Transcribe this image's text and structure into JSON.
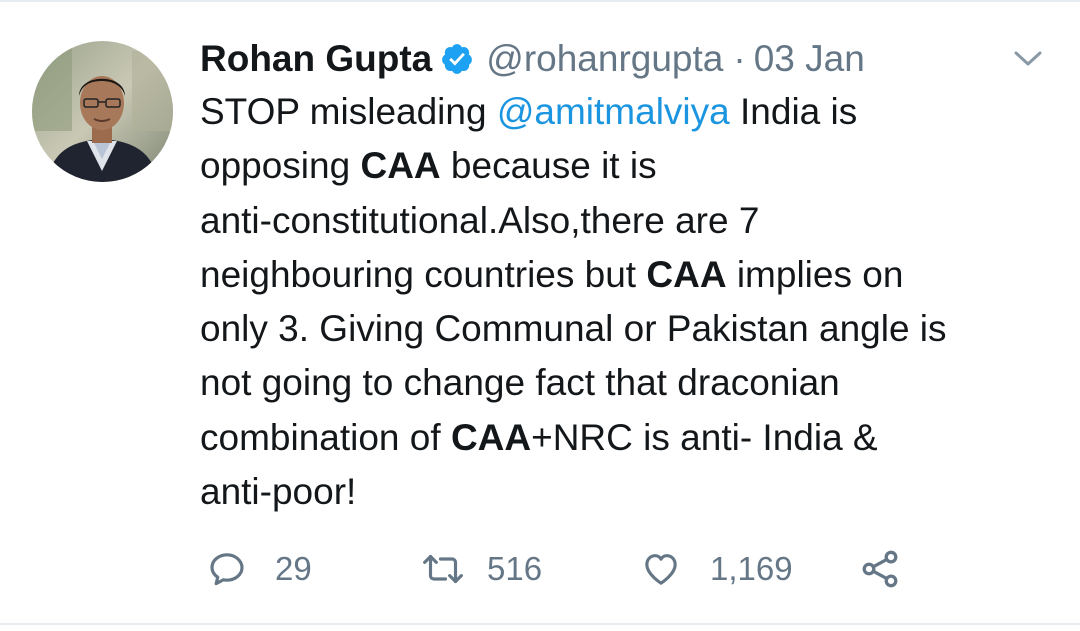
{
  "tweet": {
    "author": {
      "display_name": "Rohan Gupta",
      "handle": "@rohanrgupta",
      "verified": true,
      "avatar_icon": "avatar-photo"
    },
    "separator": "·",
    "date": "03 Jan",
    "text_lines": [
      [
        {
          "t": "STOP misleading ",
          "s": "normal"
        },
        {
          "t": "@amitmalviya",
          "s": "mention"
        },
        {
          "t": " India is",
          "s": "normal"
        }
      ],
      [
        {
          "t": "opposing ",
          "s": "normal"
        },
        {
          "t": "CAA",
          "s": "bold"
        },
        {
          "t": " because it is",
          "s": "normal"
        }
      ],
      [
        {
          "t": "anti-constitutional.Also,there are 7",
          "s": "normal"
        }
      ],
      [
        {
          "t": "neighbouring countries but ",
          "s": "normal"
        },
        {
          "t": "CAA",
          "s": "bold"
        },
        {
          "t": " implies on",
          "s": "normal"
        }
      ],
      [
        {
          "t": "only 3. Giving Communal or Pakistan angle is",
          "s": "normal"
        }
      ],
      [
        {
          "t": "not going to change fact that draconian",
          "s": "normal"
        }
      ],
      [
        {
          "t": "combination of ",
          "s": "normal"
        },
        {
          "t": "CAA",
          "s": "bold"
        },
        {
          "t": "+NRC is anti- India &",
          "s": "normal"
        }
      ],
      [
        {
          "t": "anti-poor!",
          "s": "normal"
        }
      ]
    ],
    "actions": {
      "reply_count": "29",
      "retweet_count": "516",
      "like_count": "1,169",
      "icons": [
        "reply-icon",
        "retweet-icon",
        "like-icon",
        "share-icon"
      ]
    }
  },
  "colors": {
    "text": "#14171a",
    "secondary": "#657786",
    "link": "#1b95e0",
    "verified": "#1da1f2",
    "border": "#e6ecf0"
  }
}
